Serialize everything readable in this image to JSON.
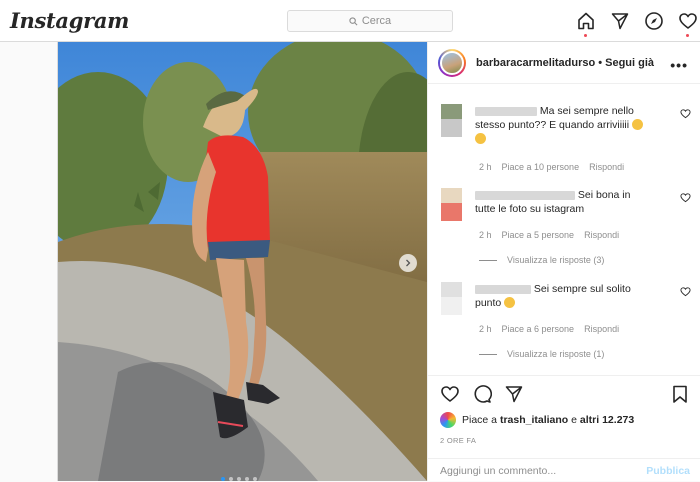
{
  "header": {
    "logo": "Instagram",
    "search_placeholder": "Cerca"
  },
  "post": {
    "owner": "barbaracarmelitadurso",
    "follow_label": "• Segui già",
    "more_label": "•••",
    "photo_count": 5,
    "comments": [
      {
        "text": "Ma sei sempre nello stesso punto?? E quando arriviiiii",
        "emoji_count": 2,
        "time": "2 h",
        "likes": "Piace a 10 persone",
        "reply": "Rispondi",
        "avatar_colors": [
          "#8a9a7a",
          "#c8c8c8"
        ]
      },
      {
        "text": "Sei bona in tutte le foto su istagram",
        "time": "2 h",
        "likes": "Piace a 5 persone",
        "reply": "Rispondi",
        "view_replies": "Visualizza le risposte (3)",
        "avatar_colors": [
          "#e8d8c0",
          "#e9776a"
        ]
      },
      {
        "text": "Sei sempre sul solito punto",
        "emoji_count": 1,
        "time": "2 h",
        "likes": "Piace a 6 persone",
        "reply": "Rispondi",
        "view_replies": "Visualizza le risposte (1)",
        "avatar_colors": [
          "#e0e0e0",
          "#f0f0f0"
        ]
      }
    ],
    "liked_by_prefix": "Piace a ",
    "liked_by_user": "trash_italiano",
    "liked_by_mid": " e ",
    "liked_by_others": "altri 12.273",
    "time_ago": "2 ORE FA",
    "add_comment_placeholder": "Aggiungi un commento...",
    "publish_label": "Pubblica"
  },
  "colors": {
    "accent": "#0095f6",
    "publish_disabled": "#b2dffc",
    "notification": "#ed4956",
    "muted": "#8e8e8e"
  }
}
